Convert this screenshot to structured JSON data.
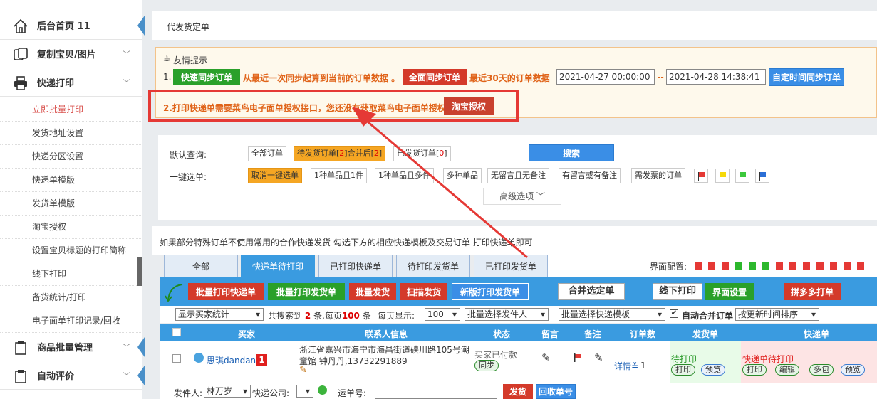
{
  "sidebar": {
    "main_items": [
      "后台首页 11",
      "复制宝贝/图片",
      "快递打印",
      "商品批量管理",
      "自动评价"
    ],
    "sub_items": [
      "立即批量打印",
      "发货地址设置",
      "快递分区设置",
      "快递单模版",
      "发货单模版",
      "淘宝授权",
      "设置宝贝标题的打印简称",
      "线下打印",
      "备货统计/打印",
      "电子面单打印记录/回收"
    ]
  },
  "breadcrumb": "代发货定单",
  "notice": {
    "title": "友情提示",
    "line1_num": "1.",
    "quick_sync": "快速同步订单",
    "quick_sync_desc": "从最近一次同步起算到当前的订单数据 。",
    "full_sync": "全面同步订单",
    "full_sync_desc": "最近30天的订单数据",
    "date_from": "2021-04-27 00:00:00",
    "date_sep": "--",
    "date_to": "2021-04-28 14:38:41",
    "custom_sync": "自定时间同步订单",
    "line2": "2.打印快递单需要菜鸟电子面单授权接口，您还没有获取菜鸟电子面单授权",
    "auth_btn": "淘宝授权"
  },
  "filter": {
    "default_label": "默认查询:",
    "all_orders": "全部订单",
    "pending_a": "待发货订单[",
    "pending_n1": "2",
    "pending_b": "]合并后[",
    "pending_n2": "2",
    "pending_c": "]",
    "shipped_a": "已发货订单[",
    "shipped_n": "0",
    "shipped_c": "]",
    "search": "搜索",
    "one_key_label": "一键选单:",
    "one_key_items": [
      "取消一键选单",
      "1种单品且1件",
      "1种单品且多件",
      "多种单品",
      "无留言且无备注",
      "有留言或有备注",
      "需发票的订单"
    ],
    "flag_colors": [
      "#e53935",
      "#f5d90a",
      "#3cc83c",
      "#2b6fd6"
    ],
    "advanced": "高级选项"
  },
  "hint": "如果部分特殊订单不使用常用的合作快递发货 勾选下方的相应快递模板及交易订单 打印快递单即可",
  "tabs": [
    "全部",
    "快递单待打印",
    "已打印快递单",
    "待打印发货单",
    "已打印发货单"
  ],
  "ui_config": {
    "label": "界面配置:",
    "squares": [
      "#e53935",
      "#e53935",
      "#e53935",
      "#2db82d",
      "#2db82d",
      "#2db82d",
      "#e53935",
      "#e53935",
      "#e53935",
      "#e53935",
      "#e53935",
      "#e53935",
      "#e53935"
    ]
  },
  "toolbar": {
    "batch_print_express": "批量打印快递单",
    "batch_print_invoice": "批量打印发货单",
    "batch_ship": "批量发货",
    "scan_ship": "扫描发货",
    "new_print_invoice": "新版打印发货单",
    "merge_selected": "合并选定单",
    "offline_print": "线下打印",
    "ui_settings": "界面设置",
    "pdd": "拼多多打单"
  },
  "options": {
    "show_buyer_stats": "显示买家统计",
    "search_a": "共搜索到",
    "search_n": "2",
    "search_b": "条,每页",
    "search_per": "100",
    "search_c": "条",
    "per_page_label": "每页显示:",
    "per_page": "100",
    "batch_sender": "批量选择发件人",
    "batch_template": "批量选择快递模板",
    "auto_merge": "自动合并订单",
    "sort": "按更新时间排序"
  },
  "table": {
    "headers": [
      "买家",
      "联系人信息",
      "状态",
      "留言",
      "备注",
      "订单数",
      "发货单",
      "快递单"
    ],
    "row": {
      "buyer": "思琪dandan",
      "buyer_badge": "1",
      "address_line1": "浙江省嘉兴市海宁市海昌街道硖川路105号潮",
      "address_line2": "童馆 钟丹丹,13732291889",
      "status": "买家已付款",
      "status_btn": "同步",
      "detail": "详情",
      "order_count": "1",
      "invoice_status": "待打印",
      "invoice_print": "打印",
      "invoice_preview": "预览",
      "express_status": "快递单待打印",
      "express_print": "打印",
      "express_edit": "编辑",
      "express_multi": "多包",
      "express_preview": "预览"
    }
  },
  "bottom": {
    "sender_label": "发件人:",
    "sender": "林万岁",
    "courier_label": "快递公司:",
    "waybill_label": "运单号:",
    "ship_btn": "发货",
    "recycle_btn": "回收单号"
  }
}
